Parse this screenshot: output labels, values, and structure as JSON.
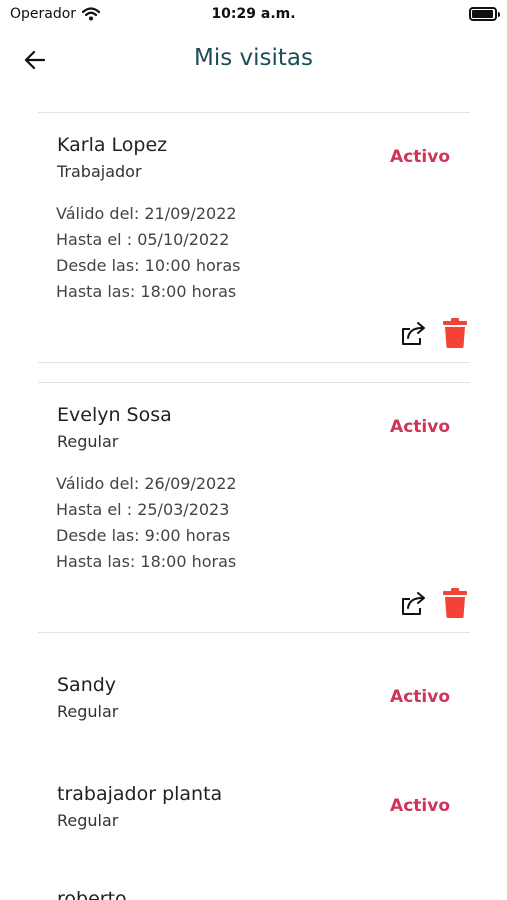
{
  "status_bar": {
    "carrier": "Operador",
    "time": "10:29 a.m."
  },
  "header": {
    "title": "Mis visitas"
  },
  "visits": [
    {
      "name": "Karla Lopez",
      "type": "Trabajador",
      "status": "Activo",
      "details": [
        "Válido del: 21/09/2022",
        "Hasta el : 05/10/2022",
        "Desde las: 10:00 horas",
        "Hasta las: 18:00 horas"
      ]
    },
    {
      "name": "Evelyn Sosa",
      "type": "Regular",
      "status": "Activo",
      "details": [
        "Válido del: 26/09/2022",
        "Hasta el : 25/03/2023",
        "Desde las: 9:00 horas",
        "Hasta las: 18:00 horas"
      ]
    },
    {
      "name": "Sandy",
      "type": "Regular",
      "status": "Activo"
    },
    {
      "name": "trabajador planta",
      "type": "Regular",
      "status": "Activo"
    },
    {
      "name": "roberto"
    }
  ],
  "colors": {
    "status": "#d1335b",
    "title": "#1d4d58",
    "trash": "#f44336"
  }
}
